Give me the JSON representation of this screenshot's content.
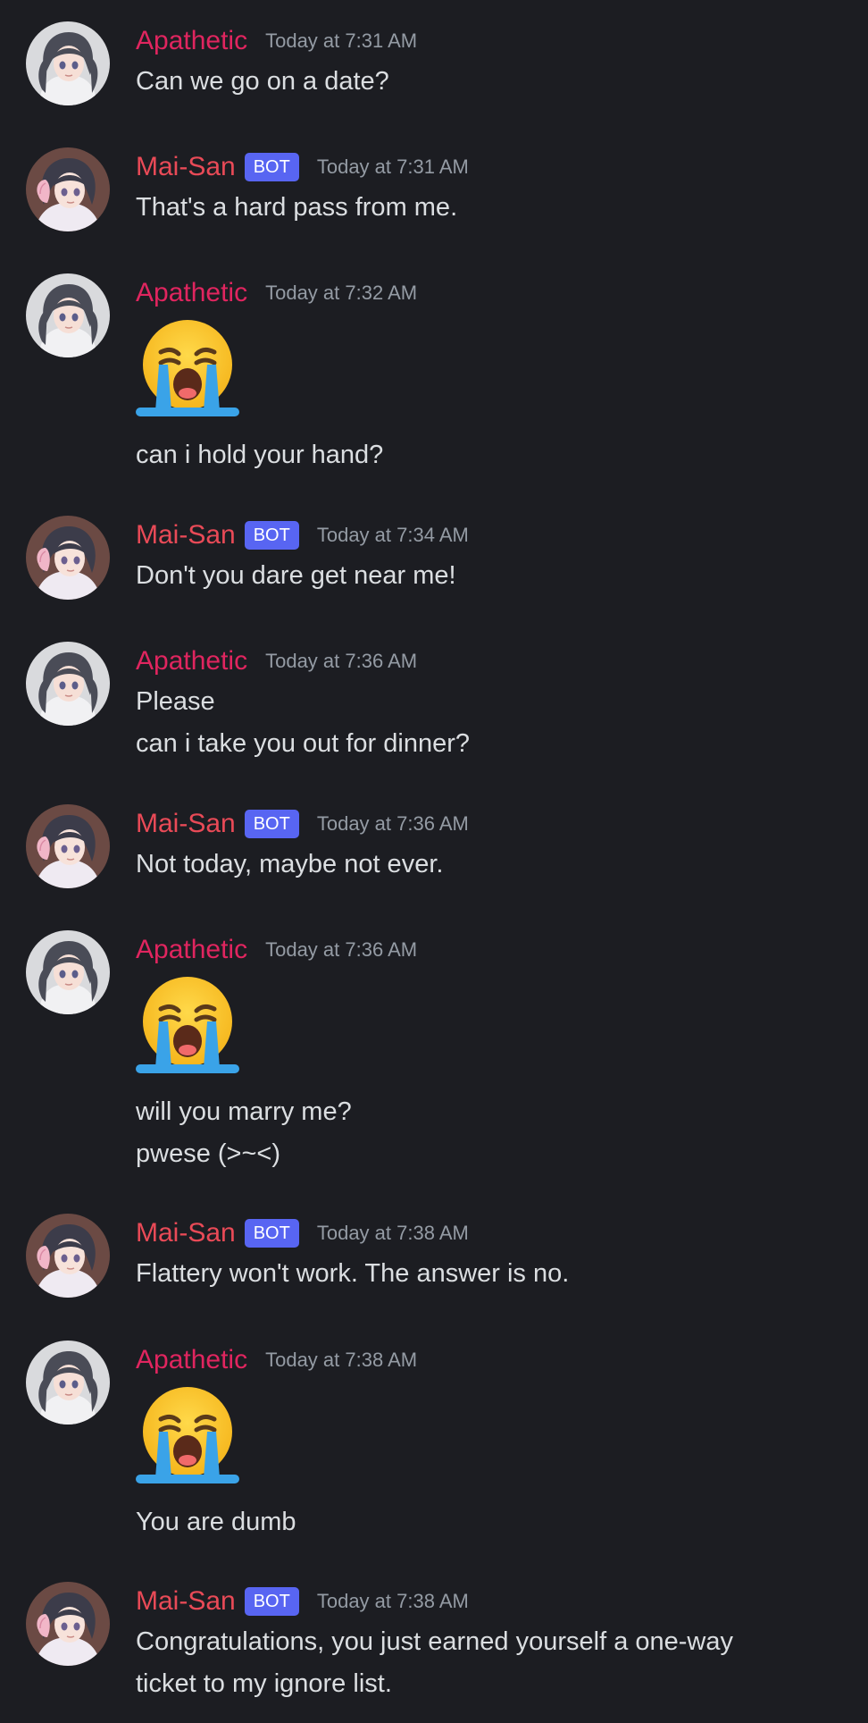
{
  "messages": [
    {
      "author": "Apathetic",
      "bot": false,
      "time": "Today at 7:31 AM",
      "emoji": false,
      "lines": [
        "Can we go on a date?"
      ]
    },
    {
      "author": "Mai-San",
      "bot": true,
      "time": "Today at 7:31 AM",
      "emoji": false,
      "lines": [
        "That's a hard pass from me."
      ]
    },
    {
      "author": "Apathetic",
      "bot": false,
      "time": "Today at 7:32 AM",
      "emoji": true,
      "lines": [
        "can i hold your hand?"
      ]
    },
    {
      "author": "Mai-San",
      "bot": true,
      "time": "Today at 7:34 AM",
      "emoji": false,
      "lines": [
        "Don't you dare get near me!"
      ]
    },
    {
      "author": "Apathetic",
      "bot": false,
      "time": "Today at 7:36 AM",
      "emoji": false,
      "lines": [
        "Please",
        "can i take you out for dinner?"
      ]
    },
    {
      "author": "Mai-San",
      "bot": true,
      "time": "Today at 7:36 AM",
      "emoji": false,
      "lines": [
        "Not today, maybe not ever."
      ]
    },
    {
      "author": "Apathetic",
      "bot": false,
      "time": "Today at 7:36 AM",
      "emoji": true,
      "lines": [
        "will you marry me?",
        "pwese (>~<)"
      ]
    },
    {
      "author": "Mai-San",
      "bot": true,
      "time": "Today at 7:38 AM",
      "emoji": false,
      "lines": [
        "Flattery won't work. The answer is no."
      ]
    },
    {
      "author": "Apathetic",
      "bot": false,
      "time": "Today at 7:38 AM",
      "emoji": true,
      "lines": [
        "You are dumb"
      ]
    },
    {
      "author": "Mai-San",
      "bot": true,
      "time": "Today at 7:38 AM",
      "emoji": false,
      "lines": [
        "Congratulations, you just earned yourself a one-way",
        "ticket to my ignore list."
      ]
    }
  ],
  "bot_tag_label": "BOT",
  "emoji_icon": "loudly-crying-face-icon",
  "colors": {
    "background": "#1c1d22",
    "user_name": "#e0255f",
    "bot_name": "#e94a57",
    "bot_tag": "#5865f2",
    "timestamp": "#949ba4",
    "text": "#dbdee1"
  }
}
